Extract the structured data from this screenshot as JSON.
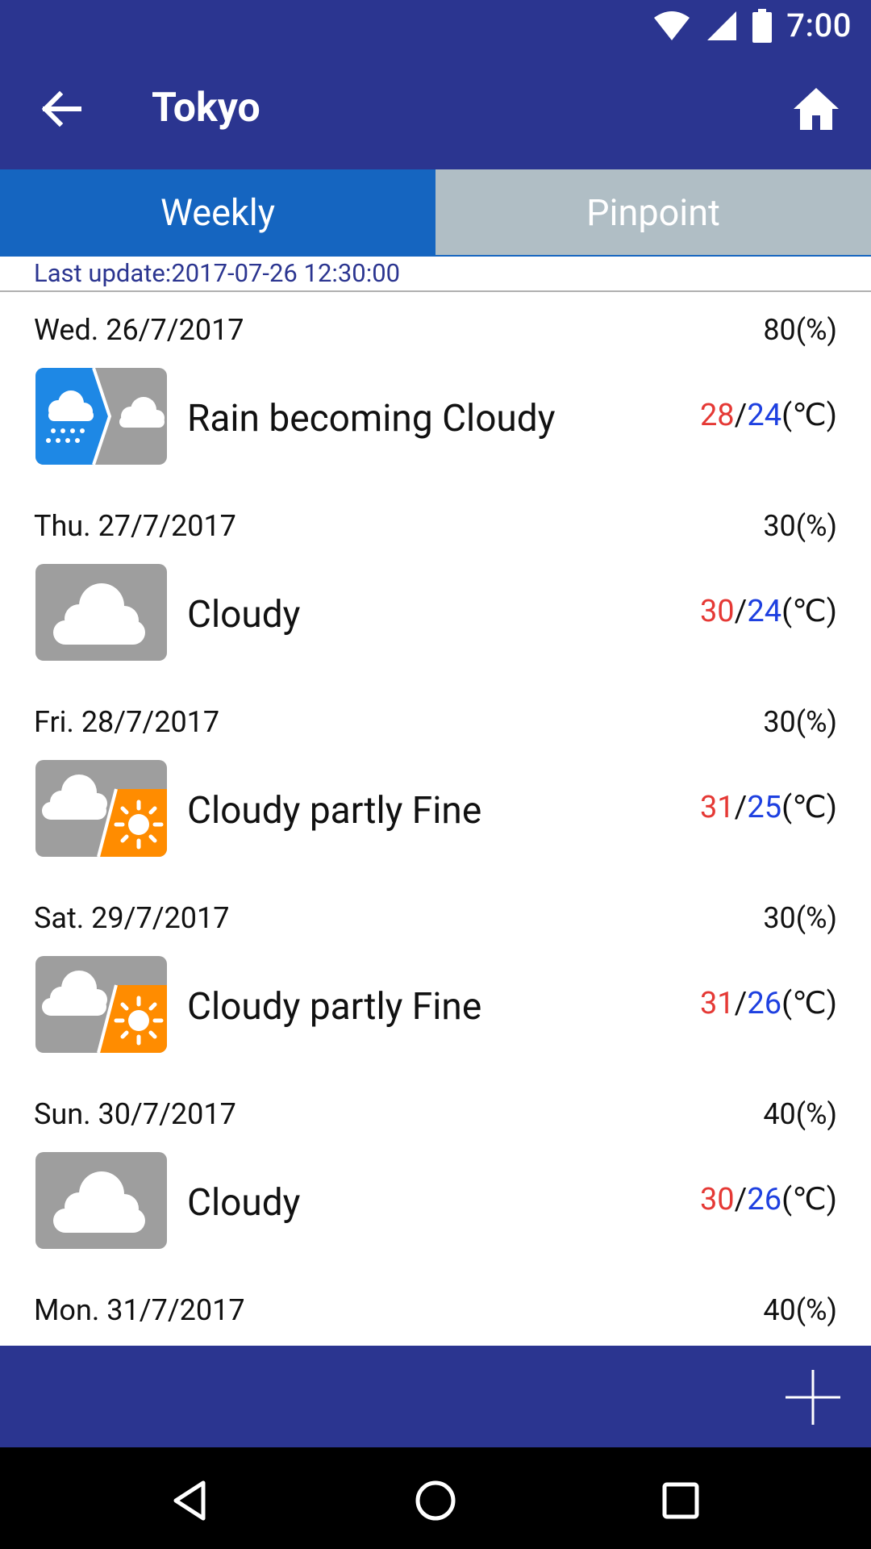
{
  "status_bar": {
    "time": "7:00",
    "icons": [
      "wifi-icon",
      "signal-icon",
      "battery-icon"
    ]
  },
  "app_bar": {
    "title": "Tokyo",
    "back_icon": "arrow-left-icon",
    "home_icon": "home-icon"
  },
  "tabs": [
    {
      "label": "Weekly",
      "active": true
    },
    {
      "label": "Pinpoint",
      "active": false
    }
  ],
  "last_update": "Last update:2017-07-26 12:30:00",
  "forecast": [
    {
      "date": "Wed. 26/7/2017",
      "precip": "80(%)",
      "condition": "Rain becoming Cloudy",
      "icon": "rain-to-cloudy-icon",
      "high": "28",
      "low": "24",
      "unit": "(℃)"
    },
    {
      "date": "Thu. 27/7/2017",
      "precip": "30(%)",
      "condition": "Cloudy",
      "icon": "cloudy-icon",
      "high": "30",
      "low": "24",
      "unit": "(℃)"
    },
    {
      "date": "Fri. 28/7/2017",
      "precip": "30(%)",
      "condition": "Cloudy partly Fine",
      "icon": "cloudy-partly-fine-icon",
      "high": "31",
      "low": "25",
      "unit": "(℃)"
    },
    {
      "date": "Sat. 29/7/2017",
      "precip": "30(%)",
      "condition": "Cloudy partly Fine",
      "icon": "cloudy-partly-fine-icon",
      "high": "31",
      "low": "26",
      "unit": "(℃)"
    },
    {
      "date": "Sun. 30/7/2017",
      "precip": "40(%)",
      "condition": "Cloudy",
      "icon": "cloudy-icon",
      "high": "30",
      "low": "26",
      "unit": "(℃)"
    },
    {
      "date": "Mon. 31/7/2017",
      "precip": "40(%)"
    }
  ],
  "temp_separator": "/",
  "bottom_bar": {
    "add_icon": "plus-icon"
  },
  "nav_bar": {
    "icons": [
      "back-triangle-icon",
      "home-circle-icon",
      "recents-square-icon"
    ]
  },
  "colors": {
    "primary": "#2B3590",
    "tab_active": "#1565C0",
    "tab_inactive": "#B0BEC5",
    "high_temp": "#E53935",
    "low_temp": "#1E40E0",
    "icon_gray": "#9E9E9E",
    "icon_blue": "#1E88E5",
    "icon_orange": "#FF8C00"
  }
}
